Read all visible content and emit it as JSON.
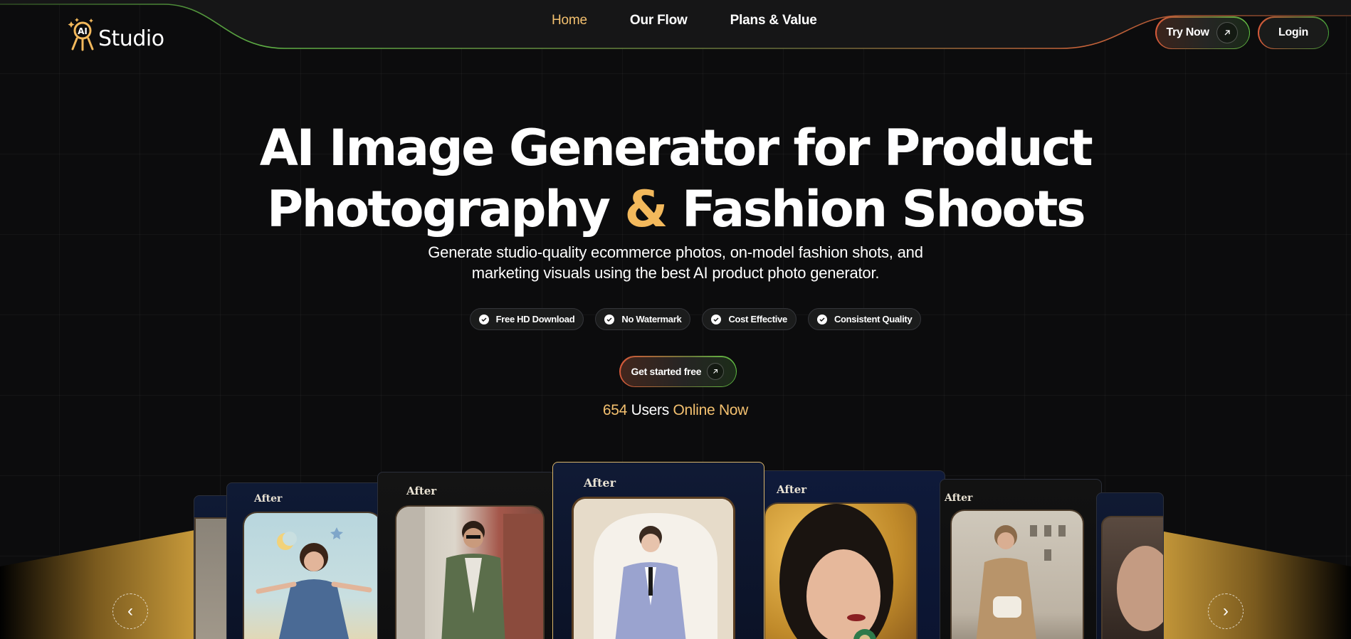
{
  "brand": {
    "logo_badge": "AI",
    "name": "Studio"
  },
  "nav": [
    {
      "label": "Home",
      "active": true
    },
    {
      "label": "Our Flow",
      "active": false
    },
    {
      "label": "Plans & Value",
      "active": false
    }
  ],
  "header_buttons": {
    "try_now": "Try Now",
    "login": "Login"
  },
  "hero": {
    "title_line1": "AI Image Generator for Product",
    "title_line2_a": "Photography",
    "title_amp": "&",
    "title_line2_b": "Fashion Shoots",
    "subtitle_line1": "Generate studio-quality ecommerce photos, on-model fashion shots, and",
    "subtitle_line2": "marketing visuals using the best AI product photo generator."
  },
  "features": [
    "Free HD Download",
    "No Watermark",
    "Cost Effective",
    "Consistent Quality"
  ],
  "cta": {
    "label": "Get started free"
  },
  "online": {
    "count": "654",
    "users": "Users",
    "status": "Online Now"
  },
  "carousel": {
    "card_label": "After",
    "prev_glyph": "‹",
    "next_glyph": "›"
  },
  "colors": {
    "accent_gold": "#f3c06f",
    "amp_gold": "#f3b95c",
    "background": "#0c0c0d",
    "header_stroke_green": "#5fb045",
    "header_stroke_orange": "#c9643a"
  },
  "icons": [
    "logo-mark-icon",
    "arrow-up-right-icon",
    "check-circle-icon",
    "chevron-left-icon",
    "chevron-right-icon"
  ]
}
